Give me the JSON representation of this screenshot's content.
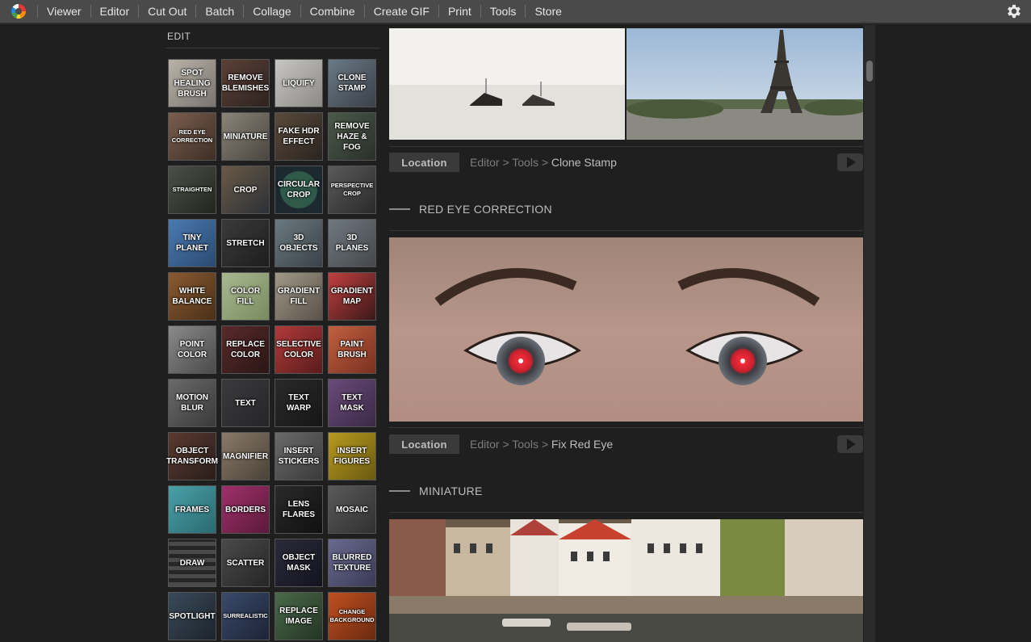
{
  "menu": {
    "items": [
      "Viewer",
      "Editor",
      "Cut Out",
      "Batch",
      "Collage",
      "Combine",
      "Create GIF",
      "Print",
      "Tools",
      "Store"
    ]
  },
  "left_panel": {
    "title": "EDIT",
    "tiles": [
      {
        "label": "SPOT HEALING BRUSH",
        "bg": "linear-gradient(135deg,#b8b2a8,#7a7470)"
      },
      {
        "label": "REMOVE BLEMISHES",
        "bg": "linear-gradient(135deg,#5a4036,#2e2320)"
      },
      {
        "label": "LIQUIFY",
        "bg": "linear-gradient(135deg,#c8c6c2,#8c8a86)"
      },
      {
        "label": "CLONE STAMP",
        "bg": "linear-gradient(135deg,#6a7a86,#3a4048)"
      },
      {
        "label": "RED EYE CORRECTION",
        "bg": "linear-gradient(135deg,#7a5e4e,#3e2e26)",
        "small": true
      },
      {
        "label": "MINIATURE",
        "bg": "linear-gradient(135deg,#8a8478,#4a4640)"
      },
      {
        "label": "FAKE HDR EFFECT",
        "bg": "linear-gradient(135deg,#5a4a3a,#2a2420)"
      },
      {
        "label": "REMOVE HAZE & FOG",
        "bg": "linear-gradient(135deg,#4a5a4a,#2a302a)"
      },
      {
        "label": "STRAIGHTEN",
        "bg": "linear-gradient(135deg,#4a5048,#22261f)",
        "small": true
      },
      {
        "label": "CROP",
        "bg": "linear-gradient(135deg,#6a5a46,#2c3036)"
      },
      {
        "label": "CIRCULAR CROP",
        "bg": "radial-gradient(circle,#2f5a4a 55%,#1c2a30 57%)"
      },
      {
        "label": "PERSPECTIVE CROP",
        "bg": "linear-gradient(135deg,#5a5a5a,#2a2a2a)",
        "small": true
      },
      {
        "label": "TINY PLANET",
        "bg": "linear-gradient(135deg,#4a7ab0,#2a4a70)"
      },
      {
        "label": "STRETCH",
        "bg": "linear-gradient(135deg,#3a3a3a,#1e1e1e)"
      },
      {
        "label": "3D OBJECTS",
        "bg": "linear-gradient(135deg,#6a7a80,#3a4248)"
      },
      {
        "label": "3D PLANES",
        "bg": "linear-gradient(135deg,#707880,#44484c)"
      },
      {
        "label": "WHITE BALANCE",
        "bg": "linear-gradient(135deg,#8a5a30,#4a3018)"
      },
      {
        "label": "COLOR FILL",
        "bg": "linear-gradient(135deg,#a8b890,#7a8a60)"
      },
      {
        "label": "GRADIENT FILL",
        "bg": "linear-gradient(135deg,#a09888,#5a5248)"
      },
      {
        "label": "GRADIENT MAP",
        "bg": "linear-gradient(135deg,#c04040,#3a1818)"
      },
      {
        "label": "POINT COLOR",
        "bg": "linear-gradient(135deg,#8a8a8a,#4a4a4a)"
      },
      {
        "label": "REPLACE COLOR",
        "bg": "linear-gradient(135deg,#5a2a2a,#2a1616)"
      },
      {
        "label": "SELECTIVE COLOR",
        "bg": "linear-gradient(135deg,#b03a3a,#5a1c1c)"
      },
      {
        "label": "PAINT BRUSH",
        "bg": "linear-gradient(135deg,#c06040,#7a3020)"
      },
      {
        "label": "MOTION BLUR",
        "bg": "linear-gradient(135deg,#6a6a6a,#3a3a3a)"
      },
      {
        "label": "TEXT",
        "bg": "linear-gradient(135deg,#3a3a3c,#262628)"
      },
      {
        "label": "TEXT WARP",
        "bg": "linear-gradient(135deg,#2a2a2a,#161616)"
      },
      {
        "label": "TEXT MASK",
        "bg": "linear-gradient(135deg,#6a4a7a,#3a2a46)"
      },
      {
        "label": "OBJECT TRANSFORM",
        "bg": "linear-gradient(135deg,#5a3a30,#2a1e1a)"
      },
      {
        "label": "MAGNIFIER",
        "bg": "linear-gradient(135deg,#8a7a68,#4a4238)"
      },
      {
        "label": "INSERT STICKERS",
        "bg": "linear-gradient(135deg,#6a6a6a,#3a3a3a)"
      },
      {
        "label": "INSERT FIGURES",
        "bg": "linear-gradient(135deg,#b89a20,#6a5a10)"
      },
      {
        "label": "FRAMES",
        "bg": "linear-gradient(135deg,#4aa0a8,#2a6a70)"
      },
      {
        "label": "BORDERS",
        "bg": "linear-gradient(135deg,#a0306a,#5a1a3a)"
      },
      {
        "label": "LENS FLARES",
        "bg": "linear-gradient(135deg,#2a2a2a,#101010)"
      },
      {
        "label": "MOSAIC",
        "bg": "linear-gradient(135deg,#5a5a5a,#303030)"
      },
      {
        "label": "DRAW",
        "bg": "repeating-linear-gradient(0deg,#4a4a4a 0 5px,#262626 5px 10px)"
      },
      {
        "label": "SCATTER",
        "bg": "linear-gradient(135deg,#4a4a4a,#262626)"
      },
      {
        "label": "OBJECT MASK",
        "bg": "linear-gradient(135deg,#2a2a3a,#141420)"
      },
      {
        "label": "BLURRED TEXTURE",
        "bg": "linear-gradient(135deg,#6a6a90,#3a3a56)"
      },
      {
        "label": "SPOTLIGHT",
        "bg": "linear-gradient(135deg,#3a4a5a,#1c242c)"
      },
      {
        "label": "SURREALISTIC",
        "bg": "linear-gradient(135deg,#3a4a6a,#1c2436)",
        "small": true
      },
      {
        "label": "REPLACE IMAGE",
        "bg": "linear-gradient(135deg,#4a6a4a,#243424)"
      },
      {
        "label": "CHANGE BACKGROUND",
        "bg": "linear-gradient(135deg,#c05020,#6a2a10)",
        "small": true
      }
    ]
  },
  "main": {
    "clone_stamp_location": {
      "badge": "Location",
      "path_prefix": "Editor > Tools > ",
      "path_last": "Clone Stamp"
    },
    "red_eye_section": {
      "title": "RED EYE CORRECTION",
      "location": {
        "badge": "Location",
        "path_prefix": "Editor > Tools > ",
        "path_last": "Fix Red Eye"
      }
    },
    "miniature_section": {
      "title": "MINIATURE"
    }
  },
  "icons": {
    "settings": "gear-icon",
    "play": "play-icon",
    "logo": "app-logo"
  }
}
